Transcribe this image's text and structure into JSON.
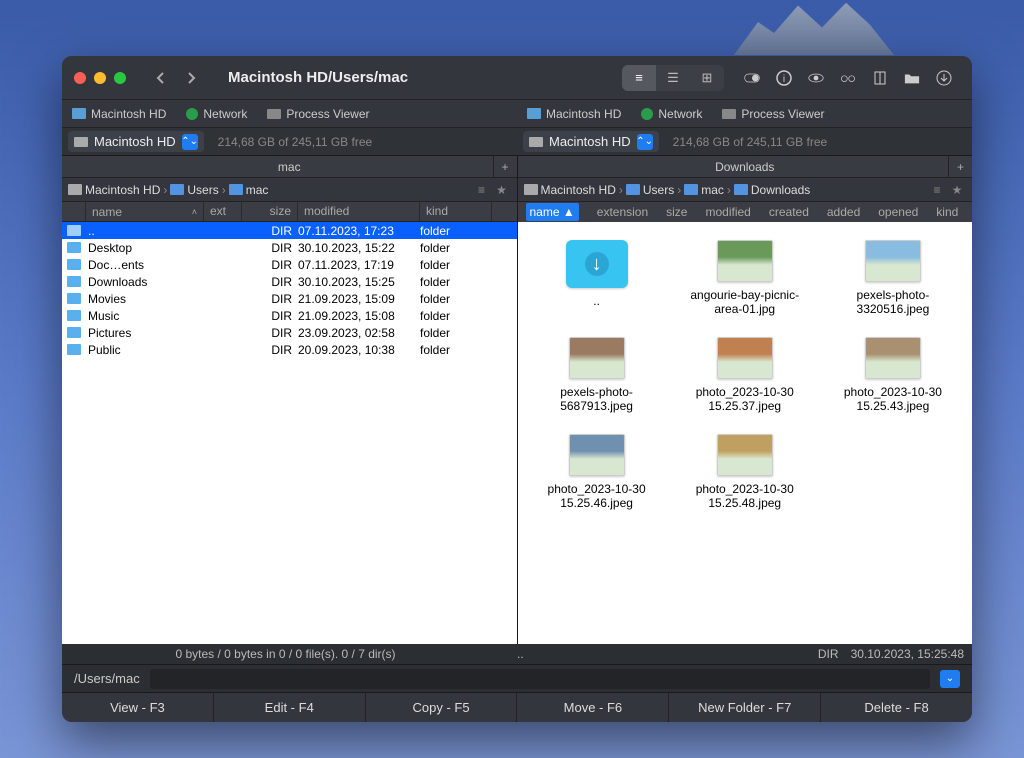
{
  "window": {
    "title_path": "Macintosh HD/Users/mac"
  },
  "tabs": [
    "Macintosh HD",
    "Network",
    "Process Viewer"
  ],
  "drive": {
    "name": "Macintosh HD",
    "freespace": "214,68 GB of 245,11 GB free"
  },
  "left": {
    "folder_title": "mac",
    "breadcrumb": [
      "Macintosh HD",
      "Users",
      "mac"
    ],
    "columns": {
      "name": "name",
      "ext": "ext",
      "size": "size",
      "modified": "modified",
      "kind": "kind"
    },
    "rows": [
      {
        "name": "..",
        "ext": "",
        "size": "DIR",
        "modified": "07.11.2023, 17:23",
        "kind": "folder",
        "selected": true
      },
      {
        "name": "Desktop",
        "ext": "",
        "size": "DIR",
        "modified": "30.10.2023, 15:22",
        "kind": "folder"
      },
      {
        "name": "Doc…ents",
        "ext": "",
        "size": "DIR",
        "modified": "07.11.2023, 17:19",
        "kind": "folder"
      },
      {
        "name": "Downloads",
        "ext": "",
        "size": "DIR",
        "modified": "30.10.2023, 15:25",
        "kind": "folder"
      },
      {
        "name": "Movies",
        "ext": "",
        "size": "DIR",
        "modified": "21.09.2023, 15:09",
        "kind": "folder"
      },
      {
        "name": "Music",
        "ext": "",
        "size": "DIR",
        "modified": "21.09.2023, 15:08",
        "kind": "folder"
      },
      {
        "name": "Pictures",
        "ext": "",
        "size": "DIR",
        "modified": "23.09.2023, 02:58",
        "kind": "folder"
      },
      {
        "name": "Public",
        "ext": "",
        "size": "DIR",
        "modified": "20.09.2023, 10:38",
        "kind": "folder"
      }
    ],
    "status": "0 bytes / 0 bytes in 0 / 0 file(s). 0 / 7 dir(s)"
  },
  "right": {
    "folder_title": "Downloads",
    "breadcrumb": [
      "Macintosh HD",
      "Users",
      "mac",
      "Downloads"
    ],
    "columns": [
      "name",
      "extension",
      "size",
      "modified",
      "created",
      "added",
      "opened",
      "kind"
    ],
    "items": [
      {
        "up": true,
        "label": ".."
      },
      {
        "label": "angourie-bay-picnic-area-01.jpg"
      },
      {
        "label": "pexels-photo-3320516.jpeg"
      },
      {
        "label": "pexels-photo-5687913.jpeg"
      },
      {
        "label": "photo_2023-10-30 15.25.37.jpeg"
      },
      {
        "label": "photo_2023-10-30 15.25.43.jpeg"
      },
      {
        "label": "photo_2023-10-30 15.25.46.jpeg"
      },
      {
        "label": "photo_2023-10-30 15.25.48.jpeg"
      }
    ],
    "status_left": "..",
    "status_dir": "DIR",
    "status_time": "30.10.2023, 15:25:48"
  },
  "cmdline": {
    "path": "/Users/mac"
  },
  "fnbar": [
    "View - F3",
    "Edit - F4",
    "Copy - F5",
    "Move - F6",
    "New Folder - F7",
    "Delete - F8"
  ],
  "icon_sort_arrow": "▲"
}
